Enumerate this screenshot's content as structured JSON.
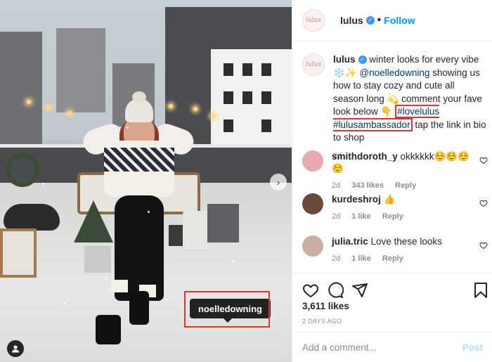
{
  "account": {
    "avatar_text": "lulus",
    "username": "lulus",
    "verified_symbol": "✓",
    "separator": "•",
    "follow_label": "Follow"
  },
  "caption": {
    "username": "lulus",
    "text1": " winter looks for every vibe ❄️✨ ",
    "mention": "@noelledowning",
    "text2": " showing us how to stay cozy and cute all season long 💫 comment your fave look below 👇 ",
    "hashtags": "#lovelulus #lulusambassador",
    "text3": " tap the link in bio to shop",
    "time": "2d"
  },
  "comments": [
    {
      "username": "smithdoroth_y",
      "text": " okkkkkk☺️☺️☺️☺️",
      "time": "2d",
      "likes": "343 likes",
      "reply": "Reply",
      "avatar_color": "#e7a9b0"
    },
    {
      "username": "kurdeshroj",
      "text": " 👍",
      "time": "2d",
      "likes": "1 like",
      "reply": "Reply",
      "avatar_color": "#6b4a3c"
    },
    {
      "username": "julia.tric",
      "text": " Love these looks",
      "time": "2d",
      "likes": "1 like",
      "reply": "Reply",
      "avatar_color": "#c8b1a4"
    }
  ],
  "actions": {
    "icons": [
      "heart-icon",
      "comment-icon",
      "share-icon",
      "bookmark-icon"
    ]
  },
  "likes": "3,611 likes",
  "date": "2 DAYS AGO",
  "add_comment": {
    "placeholder": "Add a comment...",
    "post_label": "Post"
  },
  "photo": {
    "tag_label": "noelledowning",
    "next_icon": "›"
  },
  "colors": {
    "follow": "#0095f6",
    "link": "#00376b",
    "highlight": "#e0332c",
    "verified": "#3897f0"
  }
}
